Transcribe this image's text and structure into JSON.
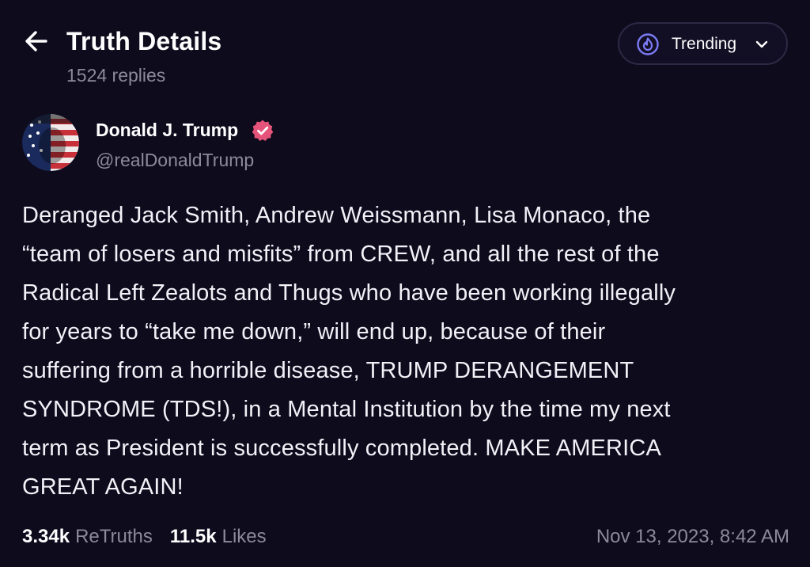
{
  "header": {
    "title": "Truth Details",
    "replies": "1524 replies",
    "back_icon": "arrow-left-icon"
  },
  "sort": {
    "label": "Trending",
    "icon": "flame-icon",
    "chevron_icon": "chevron-down-icon",
    "accent": "#7b7bf5"
  },
  "author": {
    "name": "Donald J. Trump",
    "handle": "@realDonaldTrump",
    "verified_icon": "verified-badge-icon",
    "verified_color": "#e6537a"
  },
  "post": {
    "text": "Deranged Jack Smith, Andrew Weissmann, Lisa Monaco, the\n“team of losers and misfits” from CREW, and all the rest of the\nRadical Left Zealots and Thugs who have been working illegally\nfor years to “take me down,” will end up, because of their\nsuffering from a horrible disease, TRUMP DERANGEMENT\nSYNDROME (TDS!), in a Mental Institution by the time my next\nterm as President is successfully completed. MAKE AMERICA\nGREAT AGAIN!"
  },
  "stats": {
    "retruths_value": "3.34k",
    "retruths_label": "ReTruths",
    "likes_value": "11.5k",
    "likes_label": "Likes",
    "timestamp": "Nov 13, 2023, 8:42 AM"
  }
}
